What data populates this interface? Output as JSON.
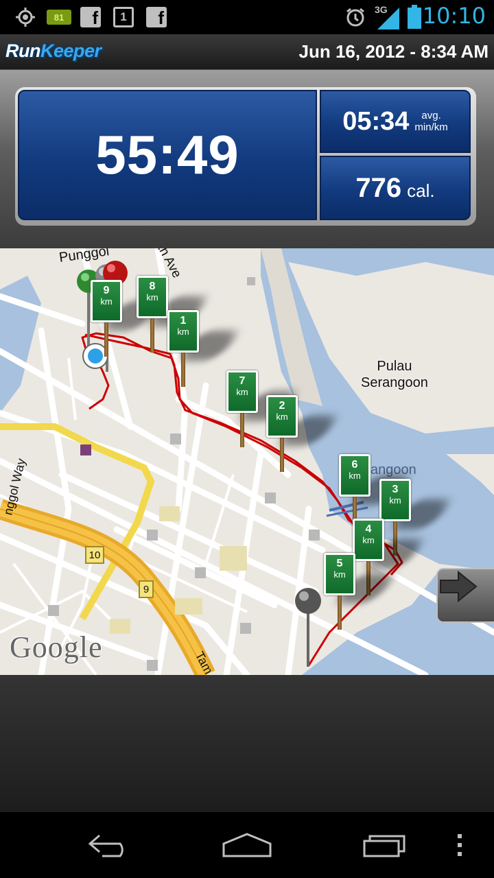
{
  "status_bar": {
    "time": "10:10",
    "network": "3G",
    "battery_level": "81",
    "left_icons": [
      "gps-icon",
      "battery-widget-icon",
      "facebook-icon",
      "calendar-icon",
      "facebook-icon"
    ],
    "right_icons": [
      "alarm-icon",
      "signal-icon",
      "battery-icon"
    ]
  },
  "header": {
    "app_logo_run": "Run",
    "app_logo_keeper": "Keeper",
    "date": "Jun 16, 2012 - 8:34 AM"
  },
  "stats": {
    "duration": "55:49",
    "pace_value": "05:34",
    "pace_unit_line1": "avg.",
    "pace_unit_line2": "min/km",
    "calories_value": "776",
    "calories_unit": "cal."
  },
  "map": {
    "labels": {
      "street_top": "Punggol",
      "street_top_tail": "th Ave",
      "island": "Pulau Serangoon",
      "island_line1": "Pulau",
      "island_line2": "Serangoon",
      "waterway_partial": "angoon",
      "road_left": "nggol Way",
      "road_bottom": "Tam",
      "route_10": "10",
      "route_9": "9"
    },
    "km_unit": "km",
    "km_markers": [
      "9",
      "8",
      "1",
      "7",
      "2",
      "6",
      "3",
      "4",
      "5"
    ],
    "attribution": "Google",
    "route_color": "#cc0000",
    "water_color": "#a7c1de"
  },
  "navigation": {
    "buttons": [
      "back-icon",
      "home-icon",
      "recent-apps-icon",
      "menu-icon"
    ]
  }
}
